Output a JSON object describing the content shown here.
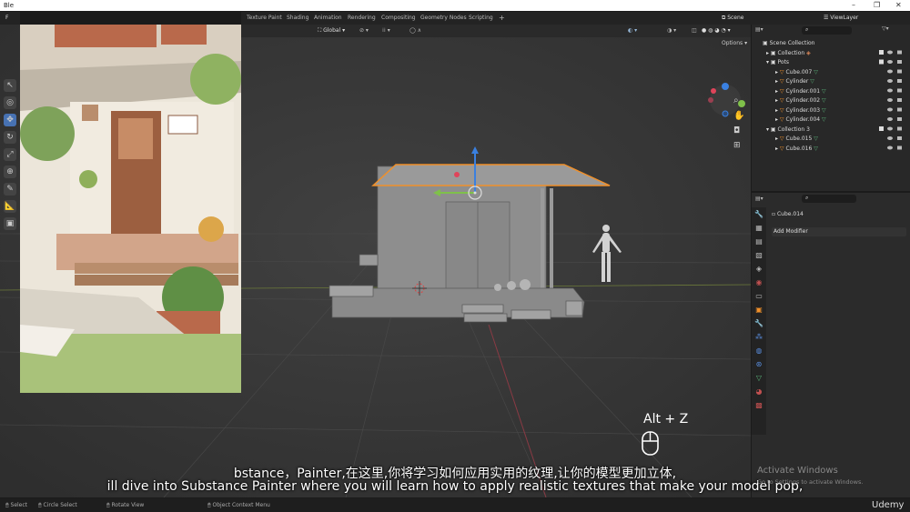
{
  "window": {
    "title": "Ble",
    "menu_letter": "F"
  },
  "window_controls": [
    "–",
    "❐",
    "✕"
  ],
  "workspace_tabs": [
    "Texture Paint",
    "Shading",
    "Animation",
    "Rendering",
    "Compositing",
    "Geometry Nodes",
    "Scripting",
    "+"
  ],
  "scene": {
    "label": "Scene",
    "view_layer": "ViewLayer"
  },
  "viewport_header": {
    "orientation": "Global",
    "options": "Options"
  },
  "outliner": {
    "root": "Scene Collection",
    "items": [
      {
        "label": "Collection",
        "level": 1
      },
      {
        "label": "Pots",
        "level": 1
      },
      {
        "label": "Cube.007",
        "level": 2
      },
      {
        "label": "Cylinder",
        "level": 2
      },
      {
        "label": "Cylinder.001",
        "level": 2
      },
      {
        "label": "Cylinder.002",
        "level": 2
      },
      {
        "label": "Cylinder.003",
        "level": 2
      },
      {
        "label": "Cylinder.004",
        "level": 2
      },
      {
        "label": "Collection 3",
        "level": 1
      },
      {
        "label": "Cube.015",
        "level": 2
      },
      {
        "label": "Cube.016",
        "level": 2
      }
    ]
  },
  "properties": {
    "object_name": "Cube.014",
    "add_modifier": "Add Modifier"
  },
  "keystroke_hint": "Alt + Z",
  "subtitles": {
    "zh": "bstance，Painter,在这里,你将学习如何应用实用的纹理,让你的模型更加立体,",
    "en": "ill dive into Substance Painter where you will learn how to apply realistic textures that make your model pop,"
  },
  "activate_windows": {
    "title": "Activate Windows",
    "subtitle": "Go to Settings to activate Windows."
  },
  "watermark": "Udemy",
  "statusbar": {
    "select": "Select",
    "circle_select": "Circle Select",
    "rotate_view": "Rotate View",
    "context_menu": "Object Context Menu"
  },
  "colors": {
    "accent": "#4772b3",
    "selection": "#f0902a",
    "gizmo_x": "#e0445a",
    "gizmo_y": "#7fc04a",
    "gizmo_z": "#3a80e0"
  }
}
